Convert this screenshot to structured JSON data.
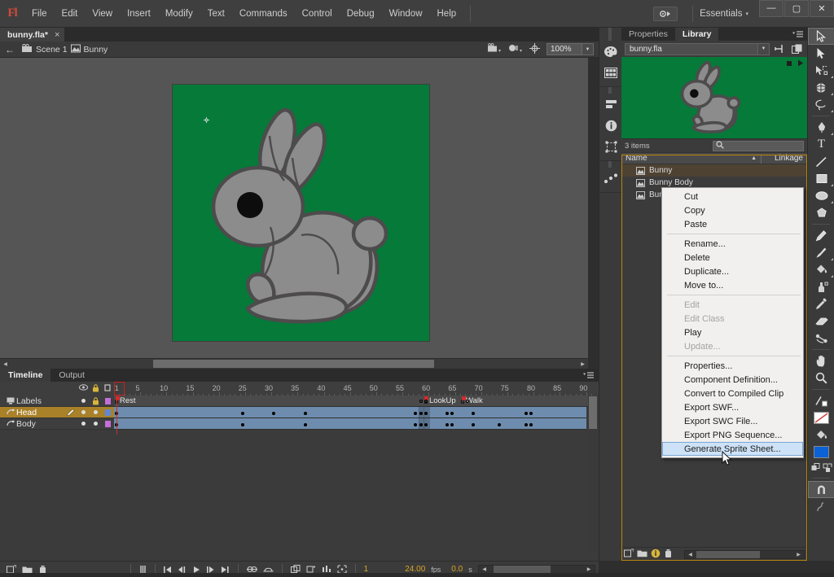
{
  "app": {
    "logo": "Fl",
    "menus": [
      "File",
      "Edit",
      "View",
      "Insert",
      "Modify",
      "Text",
      "Commands",
      "Control",
      "Debug",
      "Window",
      "Help"
    ],
    "workspace": "Essentials",
    "workspace_caret": "▾",
    "cs_button_icon": "cs-live-icon",
    "window_buttons": {
      "minimize": "—",
      "maximize": "▢",
      "close": "✕"
    }
  },
  "document": {
    "tab_title": "bunny.fla*",
    "tab_close": "×"
  },
  "editbar": {
    "back_arrow": "←",
    "crumbs": [
      {
        "label": "Scene 1",
        "icon": "scene-icon"
      },
      {
        "label": "Bunny",
        "icon": "symbol-icon"
      }
    ],
    "zoom": "100%",
    "zoom_caret": "▼",
    "icons": [
      "stage-center-icon",
      "clip-snap-icon",
      "edit-multiple-frames-icon"
    ]
  },
  "stage": {
    "background_color": "#057A39",
    "pasteboard_color": "#555555",
    "registration_icon": "registration-mark-icon",
    "artwork": "bunny-drawing",
    "body_fill": "#8c8c8c",
    "body_stroke": "#4d4b4c",
    "eye_color": "#0d0d0d"
  },
  "timeline": {
    "tabs": [
      {
        "label": "Timeline",
        "active": true
      },
      {
        "label": "Output",
        "active": false
      }
    ],
    "column_icons": [
      "eye-icon",
      "lock-icon",
      "outline-icon"
    ],
    "ruler_labels": [
      "1",
      "5",
      "10",
      "15",
      "20",
      "25",
      "30",
      "35",
      "40",
      "45",
      "50",
      "55",
      "60",
      "65",
      "70",
      "75",
      "80",
      "85",
      "90"
    ],
    "current_frame_marker": 1,
    "layers": [
      {
        "name": "Labels",
        "icon": "guide-layer-icon",
        "color": "#c46ed8",
        "selected": false,
        "locked": true,
        "pencil": false
      },
      {
        "name": "Head",
        "icon": "layer-icon",
        "color": "#5e87d8",
        "selected": true,
        "locked": false,
        "pencil": true
      },
      {
        "name": "Body",
        "icon": "layer-icon",
        "color": "#c46ed8",
        "selected": false,
        "locked": false,
        "pencil": false
      }
    ],
    "frame_labels": [
      {
        "text": "Rest",
        "frame": 1
      },
      {
        "text": "LookUp",
        "frame": 60
      },
      {
        "text": "Walk",
        "frame": 67
      }
    ],
    "head_keyframes": [
      1,
      25,
      31,
      37,
      58,
      59,
      60,
      64,
      65,
      69,
      79,
      80
    ],
    "body_keyframes": [
      1,
      25,
      37,
      58,
      59,
      60,
      64,
      65,
      69,
      74,
      79,
      80
    ],
    "span_end": 90,
    "footer": {
      "icons": [
        "new-layer-icon",
        "new-folder-icon",
        "delete-layer-icon",
        "center-frame-icon",
        "goto-first-icon",
        "step-back-icon",
        "play-icon",
        "step-forward-icon",
        "goto-last-icon",
        "onion-skin-icon",
        "onion-outline-icon",
        "edit-multiple-icon",
        "modify-onion-icon",
        "simulate-download-icon",
        "reshape-icon"
      ],
      "current_frame": "1",
      "framerate": "24.00",
      "framerate_unit": "fps",
      "elapsed": "0.0",
      "elapsed_unit": "s"
    }
  },
  "dock": {
    "groups": [
      [
        "color-palette-icon",
        "swatches-icon"
      ],
      [
        "align-icon",
        "info-icon",
        "transform-icon"
      ],
      [
        "motion-editor-icon"
      ]
    ]
  },
  "right_panel": {
    "tabs": [
      {
        "label": "Properties",
        "active": false
      },
      {
        "label": "Library",
        "active": true
      }
    ],
    "panel_menu_icon": "panel-menu-icon",
    "library": {
      "document_select": "bunny.fla",
      "select_caret": "▼",
      "pin_icon": "pin-icon",
      "new_library_panel_icon": "new-library-panel-icon",
      "preview_background": "#057A39",
      "preview_stop_icon": "stop-icon",
      "preview_play_icon": "play-icon",
      "item_count": "3 items",
      "search_placeholder": "",
      "search_icon": "search-icon",
      "columns": {
        "name": "Name",
        "linkage": "Linkage",
        "sort_arrow": "▲"
      },
      "items": [
        {
          "name": "Bunny",
          "icon": "movieclip-icon",
          "linkage": "",
          "selected": true
        },
        {
          "name": "Bunny Body",
          "icon": "movieclip-icon",
          "linkage": "",
          "selected": false
        },
        {
          "name": "Bunny Head",
          "icon": "movieclip-icon",
          "linkage": "",
          "selected": false
        }
      ],
      "footer_icons": [
        "new-symbol-icon",
        "new-folder-icon",
        "properties-icon",
        "delete-icon"
      ]
    }
  },
  "context_menu": {
    "items": [
      {
        "label": "Cut",
        "disabled": false,
        "highlighted": false
      },
      {
        "label": "Copy",
        "disabled": false,
        "highlighted": false
      },
      {
        "label": "Paste",
        "disabled": false,
        "highlighted": false
      },
      {
        "separator": true
      },
      {
        "label": "Rename...",
        "disabled": false,
        "highlighted": false
      },
      {
        "label": "Delete",
        "disabled": false,
        "highlighted": false
      },
      {
        "label": "Duplicate...",
        "disabled": false,
        "highlighted": false
      },
      {
        "label": "Move to...",
        "disabled": false,
        "highlighted": false
      },
      {
        "separator": true
      },
      {
        "label": "Edit",
        "disabled": true,
        "highlighted": false
      },
      {
        "label": "Edit Class",
        "disabled": true,
        "highlighted": false
      },
      {
        "label": "Play",
        "disabled": false,
        "highlighted": false
      },
      {
        "label": "Update...",
        "disabled": true,
        "highlighted": false
      },
      {
        "separator": true
      },
      {
        "label": "Properties...",
        "disabled": false,
        "highlighted": false
      },
      {
        "label": "Component Definition...",
        "disabled": false,
        "highlighted": false
      },
      {
        "label": "Convert to Compiled Clip",
        "disabled": false,
        "highlighted": false
      },
      {
        "label": "Export SWF...",
        "disabled": false,
        "highlighted": false
      },
      {
        "label": "Export SWC File...",
        "disabled": false,
        "highlighted": false
      },
      {
        "label": "Export PNG Sequence...",
        "disabled": false,
        "highlighted": false
      },
      {
        "label": "Generate Sprite Sheet...",
        "disabled": false,
        "highlighted": true
      }
    ]
  },
  "tools": {
    "items": [
      {
        "name": "selection-tool",
        "glyph": "arrow",
        "active": true,
        "has_submenu": false
      },
      {
        "name": "subselection-tool",
        "glyph": "arrow-solid",
        "active": false,
        "has_submenu": false
      },
      {
        "name": "free-transform-tool",
        "glyph": "transform",
        "active": false,
        "has_submenu": true
      },
      {
        "name": "3d-rotation-tool",
        "glyph": "globe",
        "active": false,
        "has_submenu": true
      },
      {
        "name": "lasso-tool",
        "glyph": "lasso",
        "active": false,
        "has_submenu": true
      },
      {
        "name": "pen-tool",
        "glyph": "pen",
        "active": false,
        "has_submenu": true
      },
      {
        "name": "text-tool",
        "glyph": "T",
        "active": false,
        "has_submenu": false
      },
      {
        "name": "line-tool",
        "glyph": "line",
        "active": false,
        "has_submenu": false
      },
      {
        "name": "rectangle-tool",
        "glyph": "rect",
        "active": false,
        "has_submenu": true
      },
      {
        "name": "oval-tool",
        "glyph": "oval",
        "active": false,
        "has_submenu": true
      },
      {
        "name": "polystar-tool",
        "glyph": "polygon",
        "active": false,
        "has_submenu": false
      },
      {
        "name": "pencil-tool",
        "glyph": "pencil",
        "active": false,
        "has_submenu": false
      },
      {
        "name": "brush-tool",
        "glyph": "brush",
        "active": false,
        "has_submenu": true
      },
      {
        "name": "paint-bucket-tool",
        "glyph": "bucket",
        "active": false,
        "has_submenu": true
      },
      {
        "name": "ink-bottle-tool",
        "glyph": "inkbottle",
        "active": false,
        "has_submenu": false
      },
      {
        "name": "eyedropper-tool",
        "glyph": "eyedropper",
        "active": false,
        "has_submenu": false
      },
      {
        "name": "eraser-tool",
        "glyph": "eraser",
        "active": false,
        "has_submenu": false
      },
      {
        "name": "bone-tool",
        "glyph": "bone",
        "active": false,
        "has_submenu": false
      },
      {
        "name": "hand-tool",
        "glyph": "hand",
        "active": false,
        "has_submenu": false
      },
      {
        "name": "zoom-tool",
        "glyph": "magnifier",
        "active": false,
        "has_submenu": false
      }
    ],
    "stroke_color": "#ffffff",
    "fill_color": "#0b61d6",
    "option_icons": [
      "snap-to-objects-icon",
      "smooth-icon"
    ]
  }
}
